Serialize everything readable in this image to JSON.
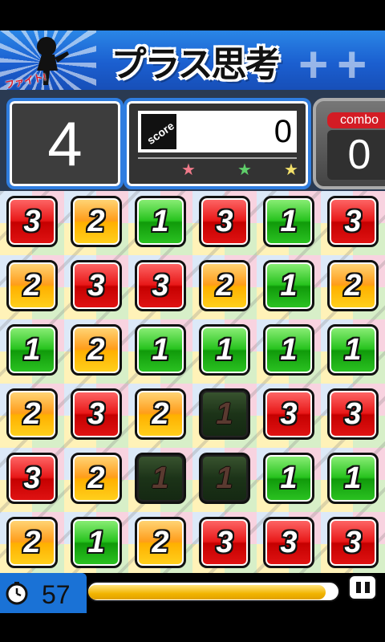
{
  "header": {
    "title": "プラス思考",
    "mascot_caption": "ファイト!"
  },
  "hud": {
    "moves_left": "4",
    "score_label": "score",
    "score_value": "0",
    "combo_label": "combo",
    "combo_value": "0",
    "score_star_colors": [
      "#f07a8a",
      "#5fcf6a",
      "#f2e06a"
    ]
  },
  "board": {
    "rows": [
      [
        {
          "value": "3",
          "color": "red",
          "state": "normal"
        },
        {
          "value": "2",
          "color": "orange",
          "state": "normal"
        },
        {
          "value": "1",
          "color": "green",
          "state": "normal"
        },
        {
          "value": "3",
          "color": "red",
          "state": "normal"
        },
        {
          "value": "1",
          "color": "green",
          "state": "normal"
        },
        {
          "value": "3",
          "color": "red",
          "state": "normal"
        }
      ],
      [
        {
          "value": "2",
          "color": "orange",
          "state": "normal"
        },
        {
          "value": "3",
          "color": "red",
          "state": "normal"
        },
        {
          "value": "3",
          "color": "red",
          "state": "normal"
        },
        {
          "value": "2",
          "color": "orange",
          "state": "normal"
        },
        {
          "value": "1",
          "color": "green",
          "state": "normal"
        },
        {
          "value": "2",
          "color": "orange",
          "state": "normal"
        }
      ],
      [
        {
          "value": "1",
          "color": "green",
          "state": "normal"
        },
        {
          "value": "2",
          "color": "orange",
          "state": "normal"
        },
        {
          "value": "1",
          "color": "green",
          "state": "normal"
        },
        {
          "value": "1",
          "color": "green",
          "state": "normal"
        },
        {
          "value": "1",
          "color": "green",
          "state": "normal"
        },
        {
          "value": "1",
          "color": "green",
          "state": "normal"
        }
      ],
      [
        {
          "value": "2",
          "color": "orange",
          "state": "normal"
        },
        {
          "value": "3",
          "color": "red",
          "state": "normal"
        },
        {
          "value": "2",
          "color": "orange",
          "state": "normal"
        },
        {
          "value": "1",
          "color": "dark",
          "state": "selected"
        },
        {
          "value": "3",
          "color": "red",
          "state": "normal"
        },
        {
          "value": "3",
          "color": "red",
          "state": "normal"
        }
      ],
      [
        {
          "value": "3",
          "color": "red",
          "state": "normal"
        },
        {
          "value": "2",
          "color": "orange",
          "state": "normal"
        },
        {
          "value": "1",
          "color": "dark",
          "state": "selected"
        },
        {
          "value": "1",
          "color": "dark",
          "state": "selected"
        },
        {
          "value": "1",
          "color": "green",
          "state": "normal"
        },
        {
          "value": "1",
          "color": "green",
          "state": "normal"
        }
      ],
      [
        {
          "value": "2",
          "color": "orange",
          "state": "normal"
        },
        {
          "value": "1",
          "color": "green",
          "state": "normal"
        },
        {
          "value": "2",
          "color": "orange",
          "state": "normal"
        },
        {
          "value": "3",
          "color": "red",
          "state": "normal"
        },
        {
          "value": "3",
          "color": "red",
          "state": "normal"
        },
        {
          "value": "3",
          "color": "red",
          "state": "normal"
        }
      ]
    ]
  },
  "footer": {
    "timer_value": "57",
    "time_remaining_fraction": 0.95,
    "clock_icon": "clock-icon",
    "pause_icon": "pause-icon"
  }
}
